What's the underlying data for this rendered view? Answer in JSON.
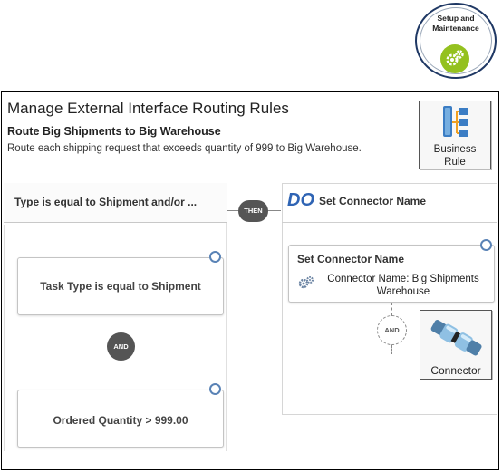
{
  "setup_badge": {
    "title_line1": "Setup and",
    "title_line2": "Maintenance",
    "icon": "gears-icon",
    "color": "#94c11f"
  },
  "header": {
    "page_title": "Manage External Interface Routing Rules",
    "rule_name": "Route Big Shipments to Big Warehouse",
    "rule_description": "Route each shipping request that exceeds quantity of 999 to Big Warehouse."
  },
  "business_rule_tile": {
    "label_line1": "Business",
    "label_line2": "Rule",
    "icon": "business-rule-icon"
  },
  "condition_panel": {
    "header": "Type is equal to Shipment and/or ...",
    "conditions": [
      {
        "text": "Task Type is equal to Shipment"
      },
      {
        "text": "Ordered Quantity > 999.00"
      }
    ],
    "operator": "AND"
  },
  "then_label": "THEN",
  "action_panel": {
    "do_label": "DO",
    "title": "Set Connector Name",
    "card": {
      "title": "Set Connector Name",
      "detail_line1": "Connector Name: Big Shipments",
      "detail_line2": "Warehouse",
      "icon": "gears-icon"
    },
    "operator": "AND"
  },
  "connector_tile": {
    "label": "Connector",
    "icon": "connector-icon"
  },
  "colors": {
    "accent": "#2f64b4",
    "selection": "#5a83b6",
    "bubble": "#555555"
  }
}
